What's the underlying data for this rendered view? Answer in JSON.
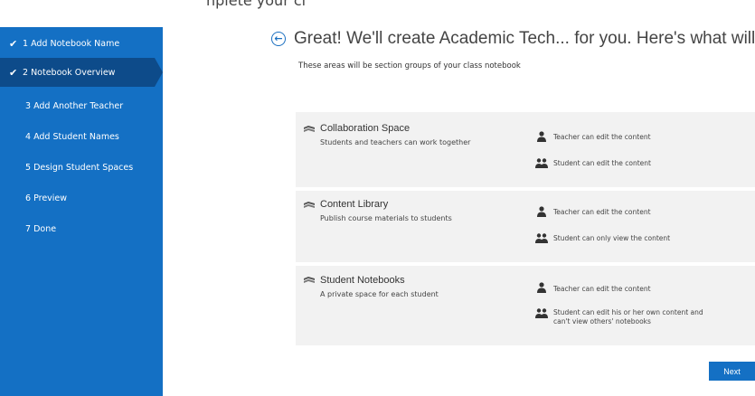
{
  "top_partial": "nplete your cl",
  "sidebar": {
    "steps": [
      {
        "label": "1 Add Notebook Name",
        "checked": true
      },
      {
        "label": "2 Notebook Overview",
        "checked": true
      },
      {
        "label": "3 Add Another Teacher",
        "checked": false
      },
      {
        "label": "4 Add Student Names",
        "checked": false
      },
      {
        "label": "5 Design Student Spaces",
        "checked": false
      },
      {
        "label": "6 Preview",
        "checked": false
      },
      {
        "label": "7 Done",
        "checked": false
      }
    ]
  },
  "main": {
    "headline": "Great! We'll create Academic Tech... for you. Here's what will be",
    "subhead": "These areas will be section groups of your class notebook",
    "sections": [
      {
        "title": "Collaboration Space",
        "desc": "Students and teachers can work together",
        "teacher_perm": "Teacher can edit the content",
        "student_perm": "Student can edit the content"
      },
      {
        "title": "Content Library",
        "desc": "Publish course materials to students",
        "teacher_perm": "Teacher can edit the content",
        "student_perm": "Student can only view the content"
      },
      {
        "title": "Student Notebooks",
        "desc": "A private space for each student",
        "teacher_perm": "Teacher can edit the content",
        "student_perm": "Student can edit his or her own content and",
        "student_perm_2": "can't view others' notebooks"
      }
    ]
  },
  "footer": {
    "next_label": "Next"
  },
  "colors": {
    "sidebar": "#1470c4",
    "active_step": "#0d4b8a",
    "panel": "#f2f2f2",
    "accent": "#1a6fc0"
  },
  "icons": {
    "back": "back-arrow-circle-icon",
    "section": "section-group-icon",
    "teacher": "teacher-person-icon",
    "student": "students-group-icon",
    "check": "checkmark-icon"
  }
}
